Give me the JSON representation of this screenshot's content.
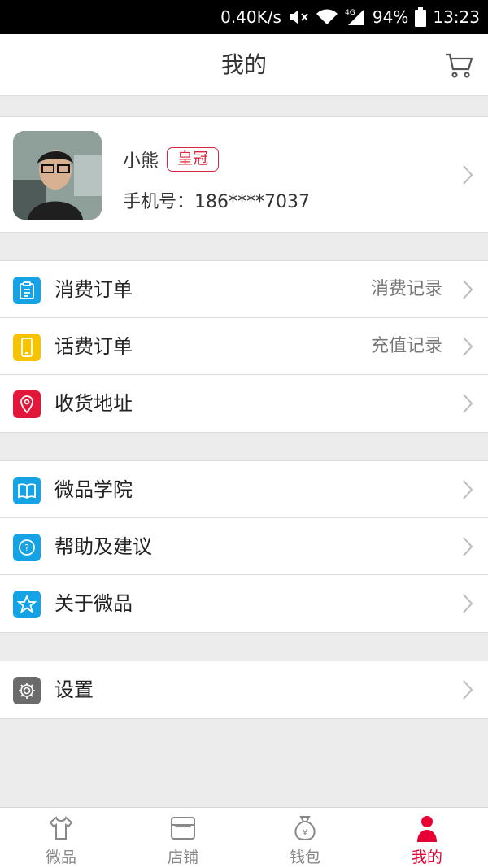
{
  "status_bar": {
    "speed": "0.40K/s",
    "battery": "94%",
    "time": "13:23",
    "network": "4G"
  },
  "header": {
    "title": "我的"
  },
  "profile": {
    "name": "小熊",
    "badge": "皇冠",
    "phone": "手机号：186****7037"
  },
  "group1": [
    {
      "label": "消费订单",
      "aux": "消费记录",
      "icon": "clipboard-icon",
      "color": "#16a3e6"
    },
    {
      "label": "话费订单",
      "aux": "充值记录",
      "icon": "phone-icon",
      "color": "#f7c300"
    },
    {
      "label": "收货地址",
      "aux": "",
      "icon": "location-pin-icon",
      "color": "#e3173a"
    }
  ],
  "group2": [
    {
      "label": "微品学院",
      "icon": "book-icon",
      "color": "#16a3e6"
    },
    {
      "label": "帮助及建议",
      "icon": "question-icon",
      "color": "#16a3e6"
    },
    {
      "label": "关于微品",
      "icon": "star-icon",
      "color": "#16a3e6"
    }
  ],
  "group3": [
    {
      "label": "设置",
      "icon": "gear-icon",
      "color": "#6b6b6b"
    }
  ],
  "tabbar": {
    "tabs": [
      {
        "label": "微品",
        "icon": "shirt-icon",
        "active": false
      },
      {
        "label": "店铺",
        "icon": "store-icon",
        "active": false
      },
      {
        "label": "钱包",
        "icon": "money-bag-icon",
        "active": false
      },
      {
        "label": "我的",
        "icon": "person-icon",
        "active": true
      }
    ],
    "active_color": "#e60033"
  }
}
